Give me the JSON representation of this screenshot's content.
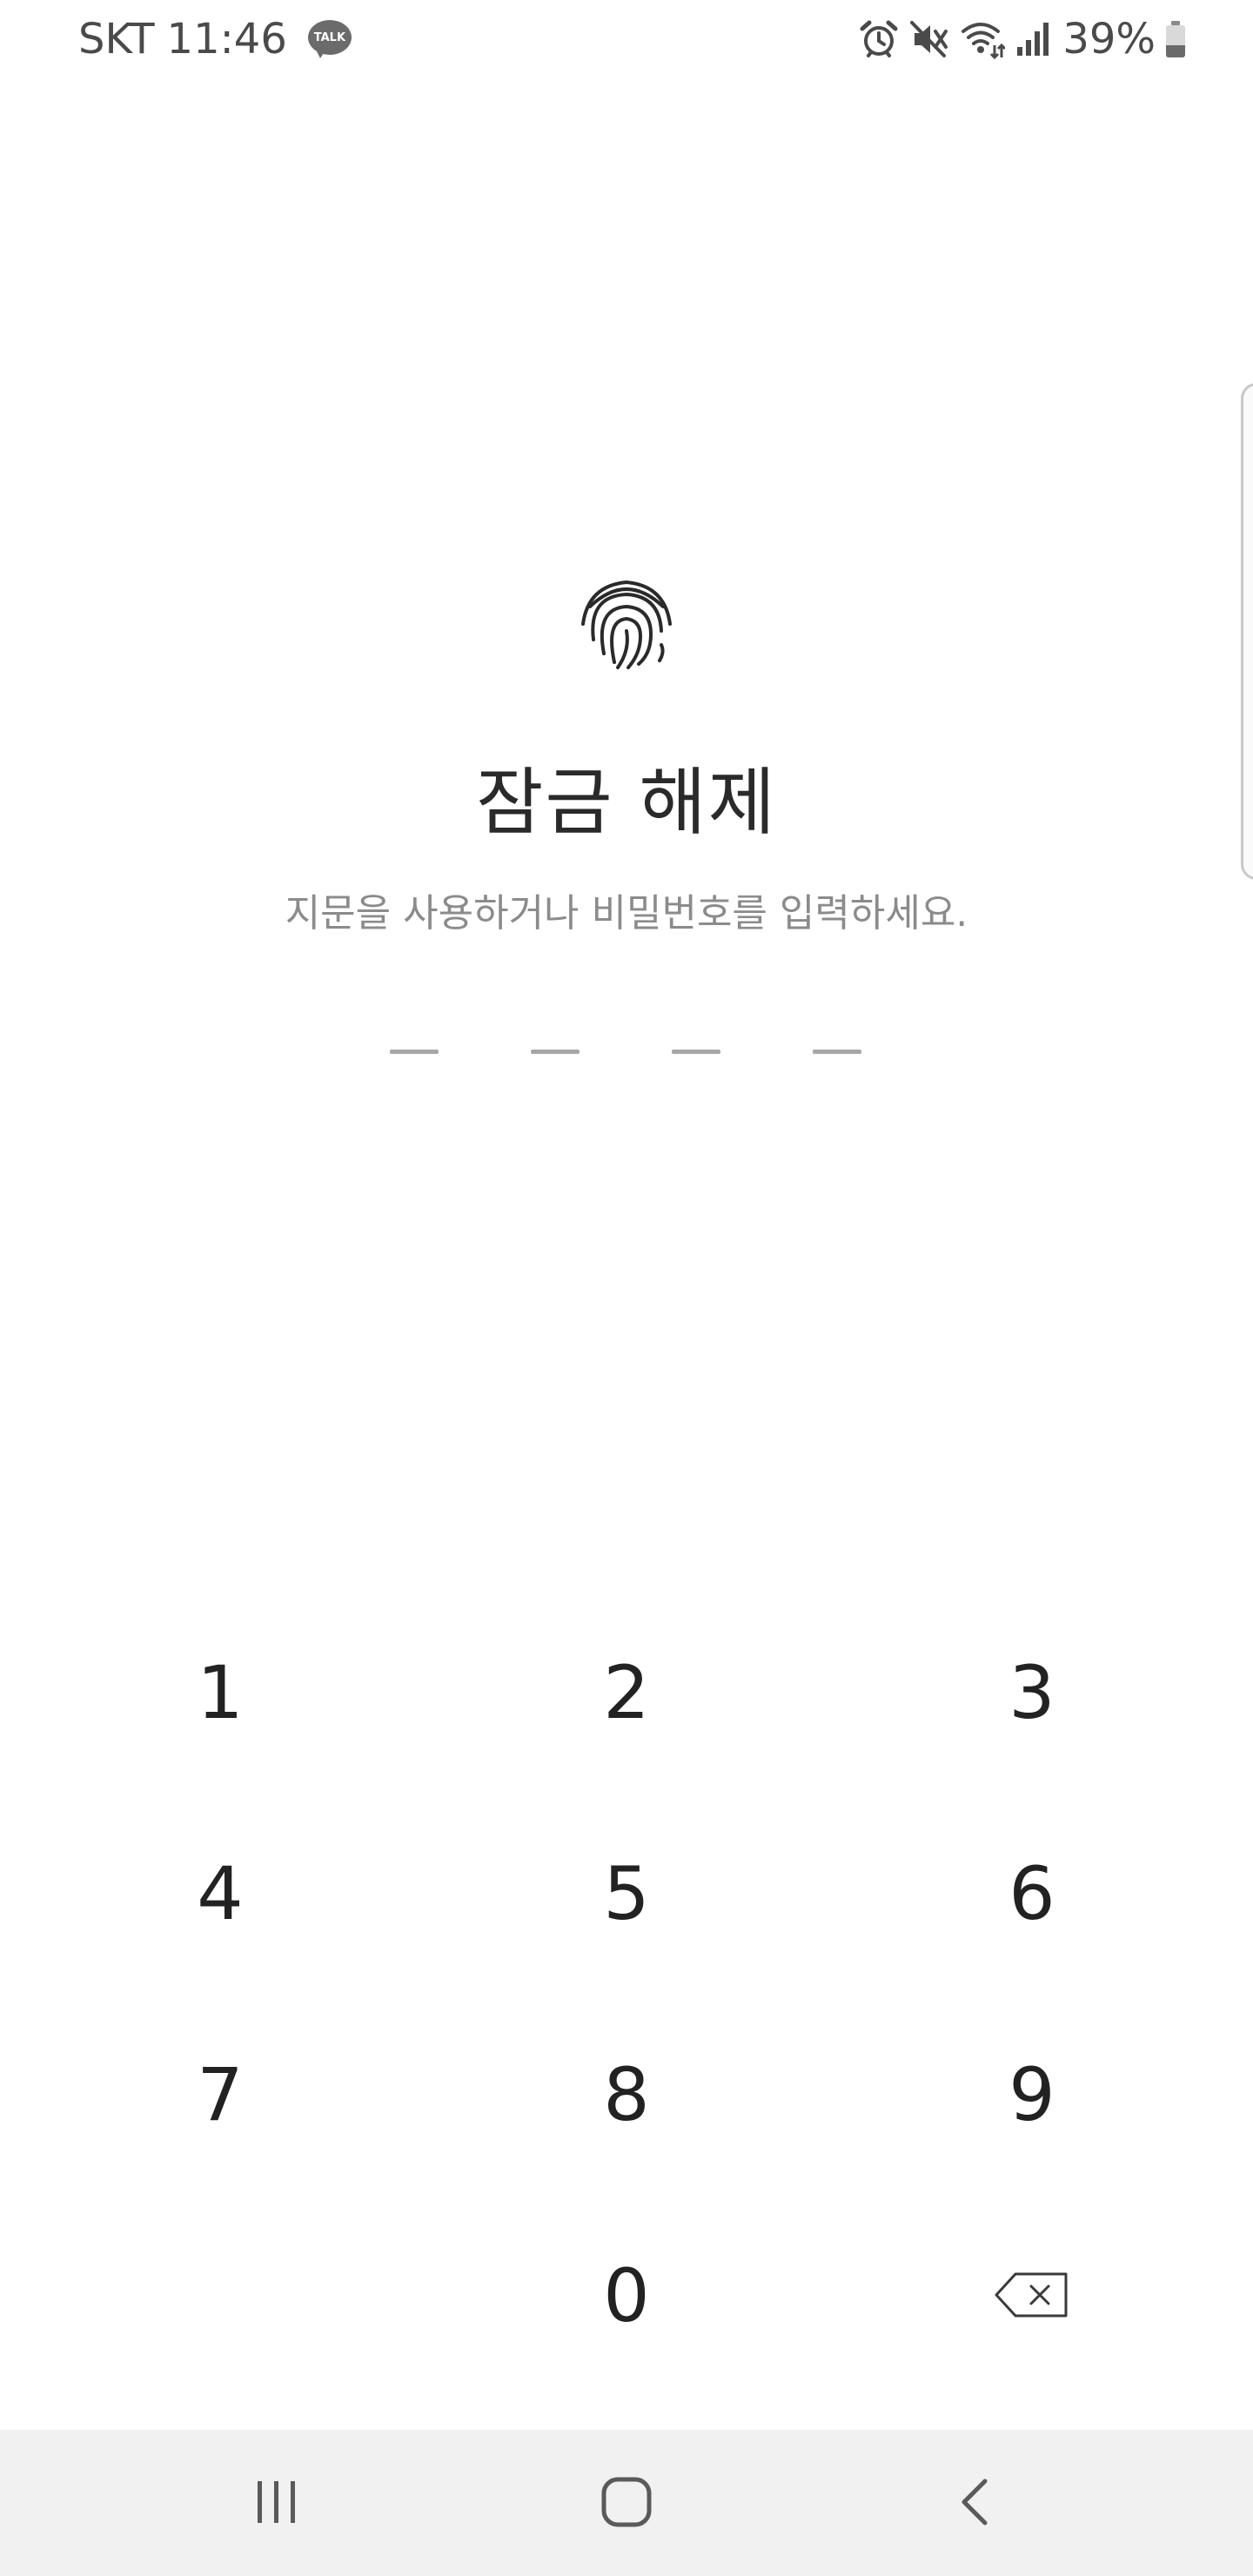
{
  "status_bar": {
    "carrier": "SKT",
    "time": "11:46",
    "notification_icon_label": "TALK",
    "battery_percent": "39%",
    "battery_level": 0.39,
    "icons": [
      "kakaotalk-icon",
      "alarm-icon",
      "mute-icon",
      "wifi-icon",
      "signal-icon",
      "battery-icon"
    ]
  },
  "lock": {
    "icon": "fingerprint-icon",
    "title": "잠금 해제",
    "subtitle": "지문을 사용하거나 비밀번호를 입력하세요.",
    "pin_length": 4,
    "entered_digits": 0
  },
  "keypad": {
    "keys": [
      {
        "label": "1"
      },
      {
        "label": "2"
      },
      {
        "label": "3"
      },
      {
        "label": "4"
      },
      {
        "label": "5"
      },
      {
        "label": "6"
      },
      {
        "label": "7"
      },
      {
        "label": "8"
      },
      {
        "label": "9"
      },
      {
        "label": ""
      },
      {
        "label": "0"
      },
      {
        "label": "",
        "icon": "backspace-icon"
      }
    ]
  },
  "nav_bar": {
    "buttons": [
      "recent-apps-icon",
      "home-icon",
      "back-icon"
    ]
  },
  "colors": {
    "background": "#ffffff",
    "text_primary": "#222222",
    "text_secondary": "#8b8b8b",
    "pin_dash": "#a7a7a7",
    "nav_bar": "#f1f1f1"
  }
}
